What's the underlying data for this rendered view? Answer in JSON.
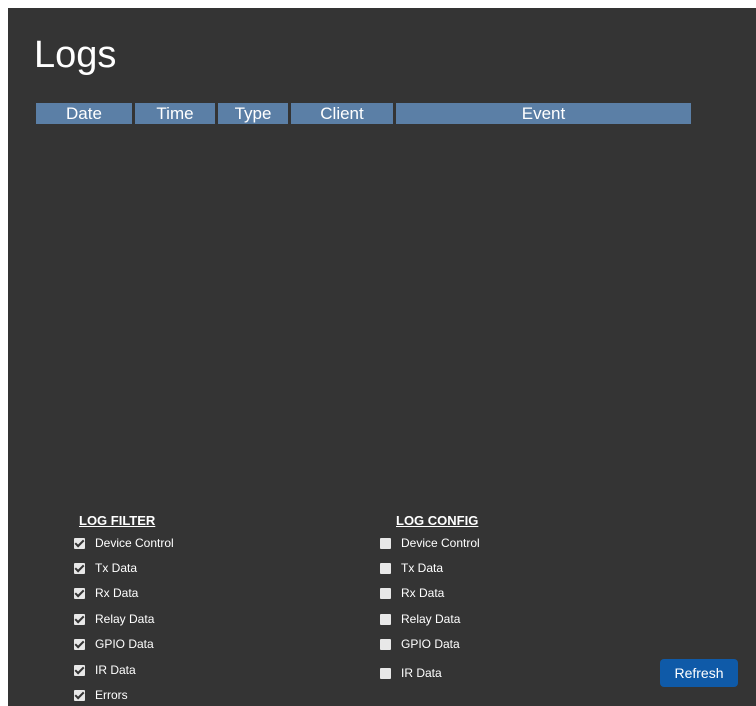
{
  "page": {
    "title": "Logs"
  },
  "log_table": {
    "columns": [
      "Date",
      "Time",
      "Type",
      "Client",
      "Event"
    ],
    "rows": []
  },
  "log_filter": {
    "title": "LOG FILTER",
    "options": [
      {
        "label": "Device Control",
        "checked": true
      },
      {
        "label": "Tx Data",
        "checked": true
      },
      {
        "label": "Rx Data",
        "checked": true
      },
      {
        "label": "Relay Data",
        "checked": true
      },
      {
        "label": "GPIO Data",
        "checked": true
      },
      {
        "label": "IR Data",
        "checked": true
      },
      {
        "label": "Errors",
        "checked": true
      }
    ]
  },
  "log_config": {
    "title": "LOG CONFIG",
    "options": [
      {
        "label": "Device Control",
        "checked": false
      },
      {
        "label": "Tx Data",
        "checked": false
      },
      {
        "label": "Rx Data",
        "checked": false
      },
      {
        "label": "Relay Data",
        "checked": false
      },
      {
        "label": "GPIO Data",
        "checked": false
      },
      {
        "label": "IR Data",
        "checked": false
      }
    ]
  },
  "actions": {
    "refresh_label": "Refresh"
  },
  "colors": {
    "panel_background": "#343434",
    "table_header": "#5b7fa6",
    "button": "#0f5aa8"
  }
}
